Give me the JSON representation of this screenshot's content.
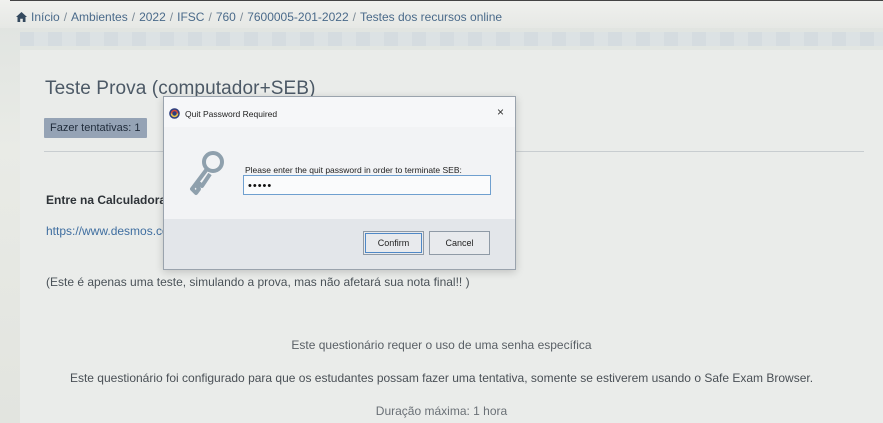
{
  "breadcrumb": {
    "items": [
      "Início",
      "Ambientes",
      "2022",
      "IFSC",
      "760",
      "7600005-201-2022",
      "Testes dos recursos online"
    ],
    "separator": "/"
  },
  "quiz": {
    "title": "Teste Prova (computador+SEB)",
    "attempts_badge": "Fazer tentativas: 1",
    "calc_heading": "Entre na Calculadora",
    "calc_link": "https://www.desmos.co",
    "note": "(Este é apenas uma teste, simulando a prova, mas não afetará sua nota final!! )",
    "requires_password": "Este questionário requer o uso de uma senha específica",
    "seb_notice": "Este questionário foi configurado para que os estudantes possam fazer uma tentativa, somente se estiverem usando o Safe Exam Browser.",
    "duration": "Duração máxima: 1 hora"
  },
  "dialog": {
    "title": "Quit Password Required",
    "close_label": "×",
    "prompt": "Please enter the quit password in order to terminate SEB:",
    "password_value": "•••••",
    "confirm_label": "Confirm",
    "cancel_label": "Cancel"
  },
  "icons": {
    "home": "home-icon",
    "app": "seb-app-icon",
    "key": "key-icon",
    "close": "close-icon"
  },
  "colors": {
    "badge_bg": "#95a3b5",
    "link": "#3f6ea0",
    "input_focus_border": "#6f9fcf"
  }
}
